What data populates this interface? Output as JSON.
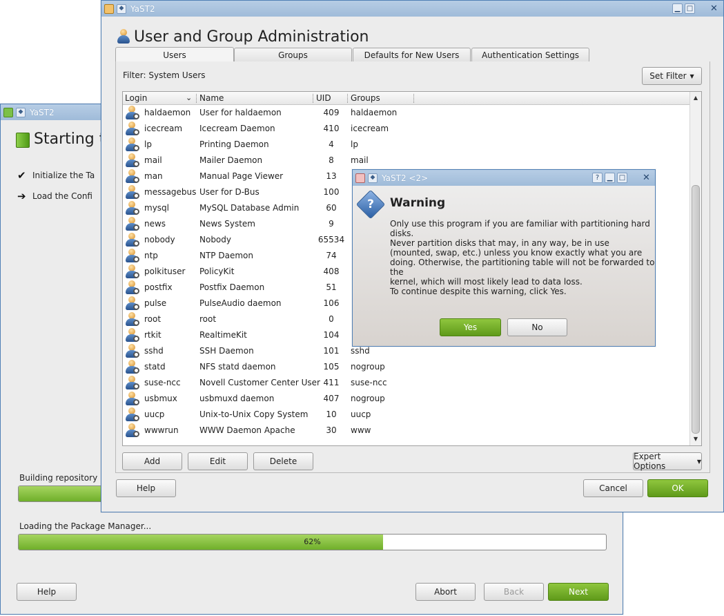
{
  "back_window": {
    "title": "YaST2",
    "heading": "Starting th",
    "steps": [
      {
        "mark": "✔",
        "label": "Initialize the Ta"
      },
      {
        "mark": "➔",
        "label": "Load the Confi"
      }
    ],
    "building_label": "Building repository 'Ya",
    "loading_label": "Loading the Package Manager...",
    "progress_percent_text": "62%",
    "progress_fraction": 0.62,
    "buttons": {
      "help": "Help",
      "abort": "Abort",
      "back": "Back",
      "next": "Next"
    }
  },
  "main_window": {
    "title": "YaST2",
    "heading": "User and Group Administration",
    "tabs": [
      {
        "label": "Users",
        "active": true
      },
      {
        "label": "Groups",
        "active": false
      },
      {
        "label": "Defaults for New Users",
        "active": false
      },
      {
        "label": "Authentication Settings",
        "active": false
      }
    ],
    "filter_label": "Filter: System Users",
    "set_filter": "Set Filter",
    "columns": [
      "Login",
      "Name",
      "UID",
      "Groups"
    ],
    "users": [
      {
        "login": "haldaemon",
        "name": "User for haldaemon",
        "uid": "409",
        "groups": "haldaemon"
      },
      {
        "login": "icecream",
        "name": "Icecream Daemon",
        "uid": "410",
        "groups": "icecream"
      },
      {
        "login": "lp",
        "name": "Printing Daemon",
        "uid": "4",
        "groups": "lp"
      },
      {
        "login": "mail",
        "name": "Mailer Daemon",
        "uid": "8",
        "groups": "mail"
      },
      {
        "login": "man",
        "name": "Manual Page Viewer",
        "uid": "13",
        "groups": ""
      },
      {
        "login": "messagebus",
        "name": "User for D-Bus",
        "uid": "100",
        "groups": ""
      },
      {
        "login": "mysql",
        "name": "MySQL Database Admin",
        "uid": "60",
        "groups": ""
      },
      {
        "login": "news",
        "name": "News System",
        "uid": "9",
        "groups": ""
      },
      {
        "login": "nobody",
        "name": "Nobody",
        "uid": "65534",
        "groups": ""
      },
      {
        "login": "ntp",
        "name": "NTP Daemon",
        "uid": "74",
        "groups": ""
      },
      {
        "login": "polkituser",
        "name": "PolicyKit",
        "uid": "408",
        "groups": ""
      },
      {
        "login": "postfix",
        "name": "Postfix Daemon",
        "uid": "51",
        "groups": ""
      },
      {
        "login": "pulse",
        "name": "PulseAudio daemon",
        "uid": "106",
        "groups": ""
      },
      {
        "login": "root",
        "name": "root",
        "uid": "0",
        "groups": ""
      },
      {
        "login": "rtkit",
        "name": "RealtimeKit",
        "uid": "104",
        "groups": ""
      },
      {
        "login": "sshd",
        "name": "SSH Daemon",
        "uid": "101",
        "groups": "sshd"
      },
      {
        "login": "statd",
        "name": "NFS statd daemon",
        "uid": "105",
        "groups": "nogroup"
      },
      {
        "login": "suse-ncc",
        "name": "Novell Customer Center User",
        "uid": "411",
        "groups": "suse-ncc"
      },
      {
        "login": "usbmux",
        "name": "usbmuxd daemon",
        "uid": "407",
        "groups": "nogroup"
      },
      {
        "login": "uucp",
        "name": "Unix-to-Unix Copy System",
        "uid": "10",
        "groups": "uucp"
      },
      {
        "login": "wwwrun",
        "name": "WWW Daemon Apache",
        "uid": "30",
        "groups": "www"
      }
    ],
    "buttons": {
      "add": "Add",
      "edit": "Edit",
      "delete": "Delete",
      "expert": "Expert Options",
      "help": "Help",
      "cancel": "Cancel",
      "ok": "OK"
    }
  },
  "dialog": {
    "title": "YaST2 <2>",
    "heading": "Warning",
    "line1": "Only use this program if you are familiar with partitioning hard disks.",
    "para2": [
      "Never partition disks that may, in any way, be in use",
      "(mounted, swap, etc.) unless you know exactly what you are",
      "doing. Otherwise, the partitioning table will not be forwarded to the",
      "kernel, which will most likely lead to data loss."
    ],
    "line3": "To continue despite this warning, click Yes.",
    "yes": "Yes",
    "no": "No"
  },
  "colors": {
    "accent_green": "#6faf2a",
    "titlebar_blue": "#9fbbd9"
  },
  "icons": [
    "question-icon",
    "user-icon",
    "tools-icon",
    "close-icon",
    "minimize-icon",
    "maximize-icon",
    "help-icon",
    "checkmark-icon",
    "arrow-right-icon"
  ]
}
